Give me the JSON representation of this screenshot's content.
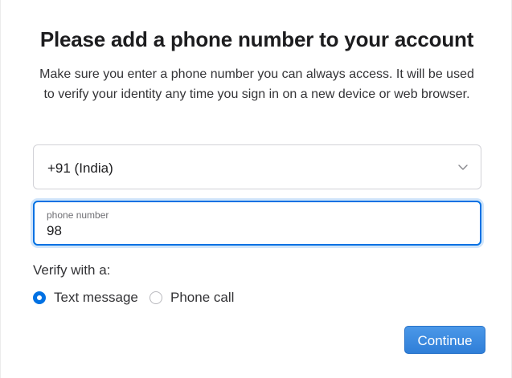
{
  "header": {
    "title": "Please add a phone number to your account",
    "description": "Make sure you enter a phone number you can always access. It will be used to verify your identity any time you sign in on a new device or web browser."
  },
  "country_select": {
    "value": "+91 (India)",
    "icon": "chevron-down-icon"
  },
  "phone_field": {
    "label": "phone number",
    "value": "98"
  },
  "verify": {
    "label": "Verify with a:",
    "options": [
      {
        "label": "Text message",
        "checked": true
      },
      {
        "label": "Phone call",
        "checked": false
      }
    ]
  },
  "actions": {
    "continue_label": "Continue"
  },
  "colors": {
    "accent": "#0071e3",
    "button": "#3a88de"
  }
}
